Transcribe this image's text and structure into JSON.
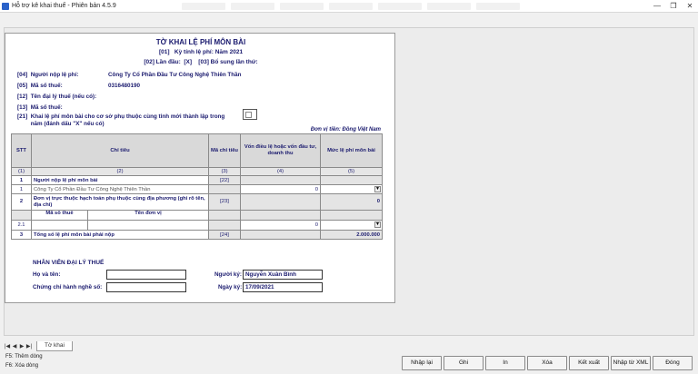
{
  "window": {
    "title": "Hỗ trợ kê khai thuế - Phiên bản 4.5.9",
    "minimize": "—",
    "maximize": "❐",
    "close": "✕"
  },
  "form": {
    "title": "TỜ KHAI LỆ PHÍ MÔN BÀI",
    "period_code": "[01]",
    "period": "Kỳ tính lệ phí: Năm 2021",
    "first_code": "[02] Lần đầu:",
    "first_mark": "[X]",
    "supplement": "[03] Bổ sung lần thứ:",
    "fields": [
      {
        "code": "[04]",
        "label": "Người nộp lệ phí:",
        "value": "Công Ty Cổ Phần Đầu Tư Công Nghệ Thiên Thần"
      },
      {
        "code": "[05]",
        "label": "Mã số thuế:",
        "value": "0316480190"
      },
      {
        "code": "[12]",
        "label": "Tên đại lý thuế (nếu có):",
        "value": ""
      },
      {
        "code": "[13]",
        "label": "Mã số thuế:",
        "value": ""
      },
      {
        "code": "[21]",
        "label": "Khai lệ phí môn bài cho cơ sở phụ thuộc cùng tỉnh mới thành lập trong",
        "label2": "năm (đánh dấu \"X\" nếu có)",
        "value": ""
      }
    ],
    "currency": "Đơn vị tiền: Đồng Việt Nam"
  },
  "table": {
    "headers": [
      "STT",
      "Chỉ tiêu",
      "Mã chỉ tiêu",
      "Vốn điều lệ hoặc vốn đầu tư, doanh thu",
      "Mức lệ phí môn bài"
    ],
    "subheaders": [
      "(1)",
      "(2)",
      "(3)",
      "(4)",
      "(5)"
    ],
    "row1": {
      "stt": "1",
      "label": "Người nộp lệ phí môn bài",
      "code": "[22]"
    },
    "row1a": {
      "stt": "1",
      "label": "Công Ty Cổ Phần Đầu Tư Công Nghệ Thiên Thần",
      "capital": "0"
    },
    "row2": {
      "stt": "2",
      "label": "Đơn vị trực thuộc hạch toán phụ thuộc cùng địa phương (ghi rõ tên, địa chỉ)",
      "code": "[23]",
      "fee": "0"
    },
    "row2h": {
      "tax_code": "Mã số thuế",
      "unit_name": "Tên đơn vị"
    },
    "row21": {
      "stt": "2.1",
      "capital": "0"
    },
    "row3": {
      "stt": "3",
      "label": "Tổng số lệ phí môn bài phải nộp",
      "code": "[24]",
      "fee": "2.000.000"
    }
  },
  "agent": {
    "header": "NHÂN VIÊN ĐẠI LÝ THUẾ",
    "name_label": "Họ và tên:",
    "name_value": "",
    "cert_label": "Chứng chỉ hành nghề số:",
    "cert_value": "",
    "signer_label": "Người ký:",
    "signer_value": "Nguyễn Xuân Bình",
    "date_label": "Ngày ký:",
    "date_value": "17/09/2021"
  },
  "sheet_tab": "Tờ khai",
  "hints": [
    "F5: Thêm dòng",
    "F6: Xóa dòng"
  ],
  "buttons": [
    "Nhập lại",
    "Ghi",
    "In",
    "Xóa",
    "Kết xuất",
    "Nhập từ XML",
    "Đóng"
  ]
}
